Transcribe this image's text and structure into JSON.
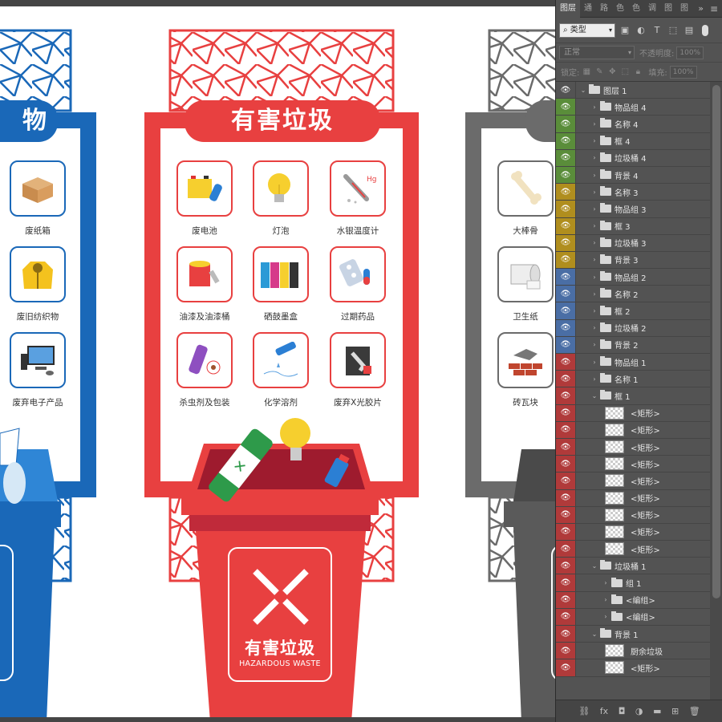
{
  "colors": {
    "hazardous": "#e84040",
    "recyclable": "#1a68b8",
    "other": "#6b6b6b",
    "label_green": "#5a8d3a",
    "label_yellow": "#b08e1e",
    "label_blue": "#4a6ea5",
    "label_red": "#b03a3a"
  },
  "artboard": {
    "left_title": "物",
    "center_title": "有害垃圾",
    "left_items": [
      {
        "label": "废纸箱",
        "icon": "cardboard-box-icon"
      },
      {
        "label": "废旧纺织物",
        "icon": "jacket-icon"
      },
      {
        "label": "废弃电子产品",
        "icon": "computer-icon"
      }
    ],
    "center_items": [
      {
        "label": "废电池",
        "icon": "battery-icon"
      },
      {
        "label": "灯泡",
        "icon": "lightbulb-icon"
      },
      {
        "label": "水银温度计",
        "icon": "thermometer-icon"
      },
      {
        "label": "油漆及油漆桶",
        "icon": "paint-bucket-icon"
      },
      {
        "label": "硒鼓墨盒",
        "icon": "ink-cartridge-icon"
      },
      {
        "label": "过期药品",
        "icon": "pills-icon"
      },
      {
        "label": "杀虫剂及包装",
        "icon": "insecticide-icon"
      },
      {
        "label": "化学溶剂",
        "icon": "chemical-solvent-icon"
      },
      {
        "label": "废弃X光胶片",
        "icon": "xray-film-icon"
      }
    ],
    "right_items": [
      {
        "label": "大棒骨",
        "icon": "bone-icon"
      },
      {
        "label": "卫生纸",
        "icon": "toilet-paper-icon"
      },
      {
        "label": "砖瓦块",
        "icon": "bricks-icon"
      }
    ],
    "bin": {
      "cn": "有害垃圾",
      "en": "HAZARDOUS WASTE"
    }
  },
  "panel": {
    "tabs": [
      "图层",
      "通",
      "路",
      "色",
      "色",
      "调",
      "图",
      "图"
    ],
    "more": "»",
    "kind": "类型",
    "blend": "正常",
    "opacity_label": "不透明度:",
    "opacity_value": "100%",
    "lock_label": "锁定:",
    "fill_label": "填充:",
    "fill_value": "100%",
    "layers": [
      {
        "name": "图层 1",
        "indent": 0,
        "type": "folder",
        "open": true,
        "color": "none"
      },
      {
        "name": "物品组 4",
        "indent": 1,
        "type": "folder",
        "color": "green"
      },
      {
        "name": "名称 4",
        "indent": 1,
        "type": "folder",
        "color": "green"
      },
      {
        "name": "框 4",
        "indent": 1,
        "type": "folder",
        "color": "green"
      },
      {
        "name": "垃圾桶 4",
        "indent": 1,
        "type": "folder",
        "color": "green"
      },
      {
        "name": "背景 4",
        "indent": 1,
        "type": "folder",
        "color": "green"
      },
      {
        "name": "名称 3",
        "indent": 1,
        "type": "folder",
        "color": "yellow"
      },
      {
        "name": "物品组 3",
        "indent": 1,
        "type": "folder",
        "color": "yellow"
      },
      {
        "name": "框 3",
        "indent": 1,
        "type": "folder",
        "color": "yellow"
      },
      {
        "name": "垃圾桶 3",
        "indent": 1,
        "type": "folder",
        "color": "yellow"
      },
      {
        "name": "背景 3",
        "indent": 1,
        "type": "folder",
        "color": "yellow"
      },
      {
        "name": "物品组 2",
        "indent": 1,
        "type": "folder",
        "color": "blue"
      },
      {
        "name": "名称 2",
        "indent": 1,
        "type": "folder",
        "color": "blue"
      },
      {
        "name": "框 2",
        "indent": 1,
        "type": "folder",
        "color": "blue"
      },
      {
        "name": "垃圾桶 2",
        "indent": 1,
        "type": "folder",
        "color": "blue"
      },
      {
        "name": "背景 2",
        "indent": 1,
        "type": "folder",
        "color": "blue"
      },
      {
        "name": "物品组 1",
        "indent": 1,
        "type": "folder",
        "color": "red"
      },
      {
        "name": "名称 1",
        "indent": 1,
        "type": "folder",
        "color": "red"
      },
      {
        "name": "框 1",
        "indent": 1,
        "type": "folder",
        "open": true,
        "color": "red"
      },
      {
        "name": "<矩形>",
        "indent": 2,
        "type": "layer",
        "color": "red"
      },
      {
        "name": "<矩形>",
        "indent": 2,
        "type": "layer",
        "color": "red"
      },
      {
        "name": "<矩形>",
        "indent": 2,
        "type": "layer",
        "color": "red"
      },
      {
        "name": "<矩形>",
        "indent": 2,
        "type": "layer",
        "color": "red"
      },
      {
        "name": "<矩形>",
        "indent": 2,
        "type": "layer",
        "color": "red"
      },
      {
        "name": "<矩形>",
        "indent": 2,
        "type": "layer",
        "color": "red"
      },
      {
        "name": "<矩形>",
        "indent": 2,
        "type": "layer",
        "color": "red"
      },
      {
        "name": "<矩形>",
        "indent": 2,
        "type": "layer",
        "color": "red"
      },
      {
        "name": "<矩形>",
        "indent": 2,
        "type": "layer",
        "color": "red"
      },
      {
        "name": "垃圾桶 1",
        "indent": 1,
        "type": "folder",
        "open": true,
        "color": "red"
      },
      {
        "name": "组 1",
        "indent": 2,
        "type": "folder",
        "color": "red"
      },
      {
        "name": "<编组>",
        "indent": 2,
        "type": "folder",
        "color": "red"
      },
      {
        "name": "<编组>",
        "indent": 2,
        "type": "folder",
        "color": "red"
      },
      {
        "name": "背景 1",
        "indent": 1,
        "type": "folder",
        "open": true,
        "color": "red"
      },
      {
        "name": "厨余垃圾",
        "indent": 2,
        "type": "layer",
        "color": "red"
      },
      {
        "name": "<矩形>",
        "indent": 2,
        "type": "layer",
        "color": "red"
      }
    ],
    "bottom_icons": [
      "link-icon",
      "fx-icon",
      "mask-icon",
      "adjustment-icon",
      "new-group-icon",
      "new-layer-icon",
      "trash-icon"
    ]
  }
}
